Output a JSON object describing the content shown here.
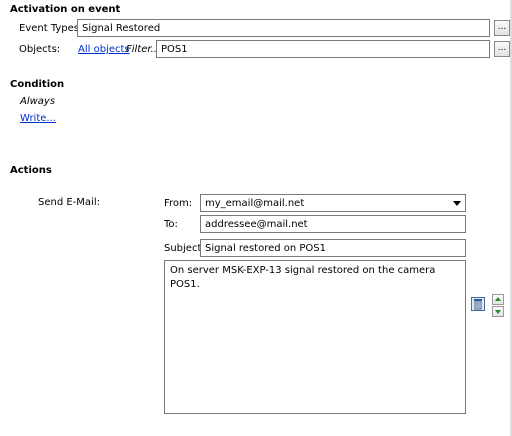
{
  "activation": {
    "title": "Activation on event",
    "event_types_label": "Event Types:",
    "event_types_value": "Signal Restored",
    "objects_label": "Objects:",
    "all_objects_link": "All objects",
    "filter_label": "Filter...",
    "filter_value": "POS1",
    "browse_label": "..."
  },
  "condition": {
    "title": "Condition",
    "value": "Always",
    "write_link": "Write..."
  },
  "actions": {
    "title": "Actions",
    "send_email_label": "Send E-Mail:",
    "from_label": "From:",
    "from_value": "my_email@mail.net",
    "to_label": "To:",
    "to_value": "addressee@mail.net",
    "subject_label": "Subject:",
    "subject_value": "Signal restored on POS1",
    "body_value": "On server MSK-EXP-13 signal restored on the camera POS1."
  },
  "icons": {
    "dropdown": "chevron-down-icon",
    "delete": "trash-icon",
    "up": "arrow-up-icon",
    "down": "arrow-down-icon"
  }
}
